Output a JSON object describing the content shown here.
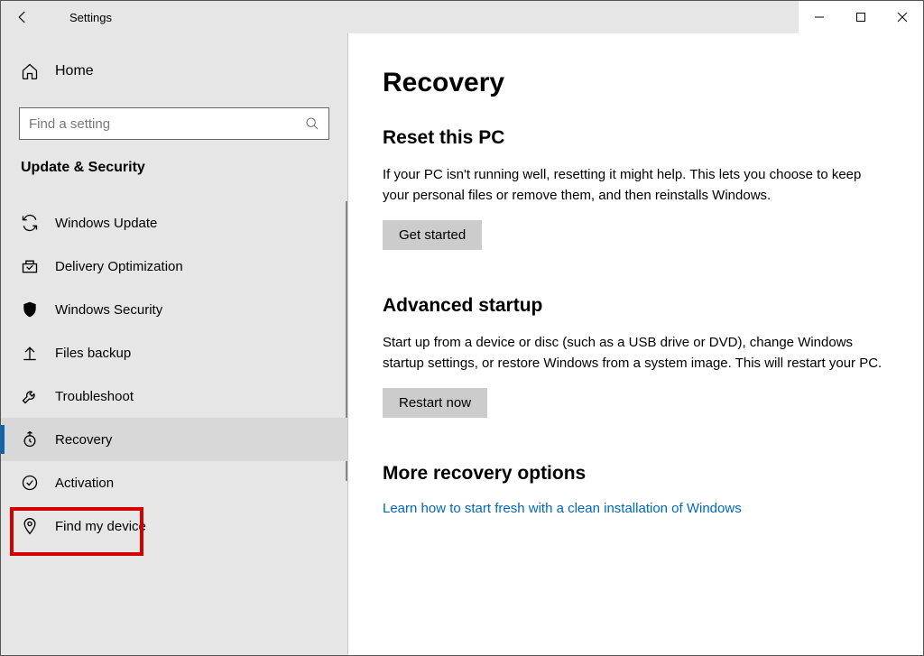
{
  "titlebar": {
    "app_title": "Settings"
  },
  "sidebar": {
    "home_label": "Home",
    "search_placeholder": "Find a setting",
    "category_title": "Update & Security",
    "items": [
      {
        "label": "Windows Update",
        "icon": "sync-icon"
      },
      {
        "label": "Delivery Optimization",
        "icon": "delivery-icon"
      },
      {
        "label": "Windows Security",
        "icon": "shield-icon"
      },
      {
        "label": "Files backup",
        "icon": "backup-icon"
      },
      {
        "label": "Troubleshoot",
        "icon": "wrench-icon"
      },
      {
        "label": "Recovery",
        "icon": "recovery-icon"
      },
      {
        "label": "Activation",
        "icon": "check-circle-icon"
      },
      {
        "label": "Find my device",
        "icon": "location-icon"
      }
    ],
    "selected_index": 5,
    "highlighted_index": 5
  },
  "main": {
    "page_title": "Recovery",
    "sections": [
      {
        "title": "Reset this PC",
        "body": "If your PC isn't running well, resetting it might help. This lets you choose to keep your personal files or remove them, and then reinstalls Windows.",
        "button": "Get started"
      },
      {
        "title": "Advanced startup",
        "body": "Start up from a device or disc (such as a USB drive or DVD), change Windows startup settings, or restore Windows from a system image. This will restart your PC.",
        "button": "Restart now"
      },
      {
        "title": "More recovery options",
        "link": "Learn how to start fresh with a clean installation of Windows"
      }
    ]
  }
}
